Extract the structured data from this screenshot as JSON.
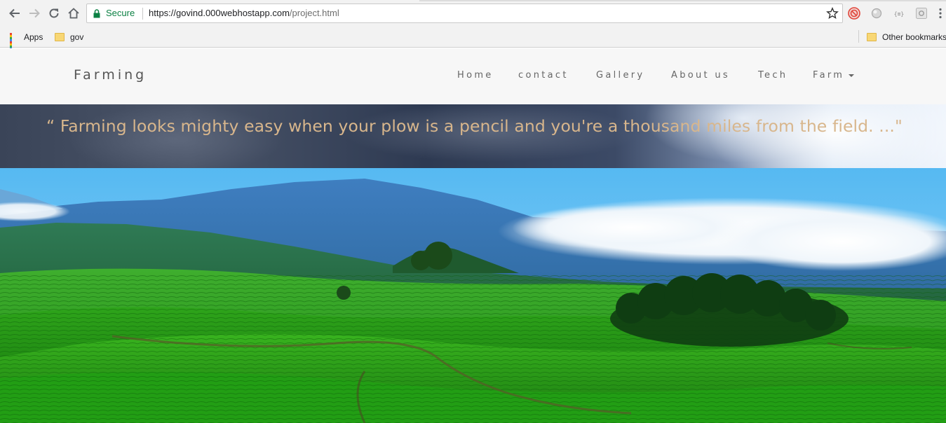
{
  "browser": {
    "secure_label": "Secure",
    "url_host": "https://govind.000webhostapp.com",
    "url_path": "/project.html",
    "bookmarks": [
      {
        "label": "Apps",
        "icon": "apps-grid-icon"
      },
      {
        "label": "gov",
        "icon": "folder-icon"
      }
    ],
    "other_bookmarks": "Other bookmarks",
    "extensions": [
      "blocked-circle-icon",
      "grey-circle-icon",
      "json-braces-icon",
      "settings-box-icon"
    ]
  },
  "site": {
    "brand": "Farming",
    "nav": [
      "Home",
      "contact",
      "Gallery",
      "About us",
      "Tech",
      "Farm"
    ],
    "quote": "“ Farming looks mighty easy when your plow is a pencil and you're a thousand miles from the field. ...\""
  },
  "colors": {
    "quote_text": "#d8b68c",
    "secure_green": "#0b8043",
    "header_bg": "#f7f7f7"
  }
}
